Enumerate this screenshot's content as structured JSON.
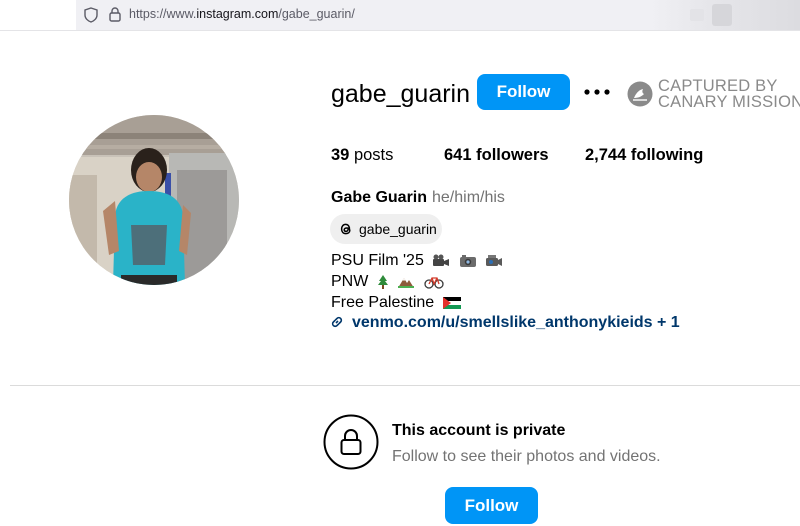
{
  "browser": {
    "url_prefix": "https://www.",
    "url_domain": "instagram.com",
    "url_path": "/gabe_guarin/"
  },
  "profile": {
    "username": "gabe_guarin",
    "follow_label": "Follow",
    "posts_count": "39",
    "posts_label": "posts",
    "followers_count": "641",
    "followers_label": "followers",
    "following_count": "2,744",
    "following_label": "following",
    "full_name": "Gabe Guarin",
    "pronouns": "he/him/his",
    "threads_handle": "gabe_guarin",
    "bio_lines": [
      "PSU Film '25",
      "PNW",
      "Free Palestine"
    ],
    "link_text": "venmo.com/u/smellslike_anthonykieids",
    "link_extra": "+ 1"
  },
  "watermark": {
    "line1": "CAPTURED BY",
    "line2": "CANARY MISSION"
  },
  "private_notice": {
    "title": "This account is private",
    "subtitle": "Follow to see their photos and videos.",
    "follow_label": "Follow"
  },
  "colors": {
    "accent": "#0095f6",
    "link": "#00376b",
    "muted": "#737373"
  },
  "icons": [
    "shield-icon",
    "lock-icon",
    "more-options-icon",
    "canary-mission-icon",
    "threads-icon",
    "link-icon",
    "private-lock-icon"
  ]
}
